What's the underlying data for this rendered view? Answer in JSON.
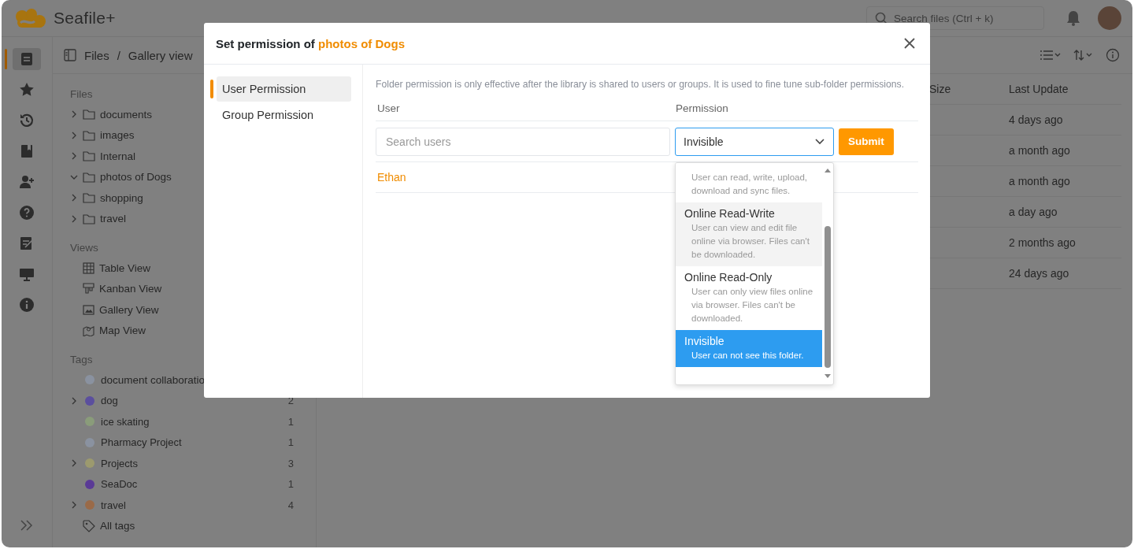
{
  "app": {
    "logo": "Seafile+",
    "search": {
      "placeholder": "Search files (Ctrl + k)"
    }
  },
  "rail": [
    {
      "kind": "files",
      "selected": true
    },
    {
      "kind": "star",
      "selected": false
    },
    {
      "kind": "history",
      "selected": false
    },
    {
      "kind": "book",
      "selected": false
    },
    {
      "kind": "useradd",
      "selected": false
    },
    {
      "kind": "help",
      "selected": false
    },
    {
      "kind": "notes",
      "selected": false
    },
    {
      "kind": "monitor",
      "selected": false
    },
    {
      "kind": "info",
      "selected": false
    }
  ],
  "sidebar": {
    "files_heading": "Files",
    "folders": [
      {
        "name": "documents",
        "expanded": false
      },
      {
        "name": "images",
        "expanded": false
      },
      {
        "name": "Internal",
        "expanded": false
      },
      {
        "name": "photos of Dogs",
        "expanded": true
      },
      {
        "name": "shopping",
        "expanded": false
      },
      {
        "name": "travel",
        "expanded": false
      }
    ],
    "views_heading": "Views",
    "views": [
      {
        "kind": "table",
        "label": "Table View"
      },
      {
        "kind": "kanban",
        "label": "Kanban View"
      },
      {
        "kind": "gallery",
        "label": "Gallery View"
      },
      {
        "kind": "map",
        "label": "Map View"
      }
    ],
    "tags_heading": "Tags",
    "tags": [
      {
        "name": "document collaboratio",
        "color": "#8a92a0",
        "expandable": false
      },
      {
        "name": "dog",
        "count": "2",
        "color": "#5b4f9e",
        "expandable": true
      },
      {
        "name": "ice skating",
        "count": "1",
        "color": "#8a9c7a",
        "expandable": false
      },
      {
        "name": "Pharmacy Project",
        "count": "1",
        "color": "#8a92a0",
        "expandable": false
      },
      {
        "name": "Projects",
        "count": "3",
        "color": "#9c9a6e",
        "expandable": true
      },
      {
        "name": "SeaDoc",
        "count": "1",
        "color": "#5a3a96",
        "expandable": false
      },
      {
        "name": "travel",
        "count": "4",
        "color": "#9a6a48",
        "expandable": true
      }
    ],
    "all_tags": "All tags"
  },
  "breadcrumb": {
    "items": [
      "Files",
      "Gallery view"
    ],
    "separator": "/"
  },
  "table": {
    "columns": [
      "Size",
      "Last Update"
    ],
    "rows": [
      "4 days ago",
      "a month ago",
      "a month ago",
      "a day ago",
      "2 months ago",
      "24 days ago"
    ]
  },
  "dialog": {
    "title": "Set permission of ",
    "folder": "photos of Dogs",
    "tabs": [
      {
        "label": "User Permission",
        "selected": true
      },
      {
        "label": "Group Permission",
        "selected": false
      }
    ],
    "notice": "Folder permission is only effective after the library is shared to users or groups. It is used to fine tune sub-folder permissions.",
    "columns": [
      "User",
      "Permission"
    ],
    "user_search": {
      "placeholder": "Search users"
    },
    "permission_value": "Invisible",
    "submit": "Submit",
    "users": [
      "Ethan"
    ],
    "options": [
      {
        "description": "User can read, write, upload, download and sync files.",
        "hovered": false,
        "selected": false
      },
      {
        "title": "Online Read-Write",
        "description": "User can view and edit file online via browser. Files can't be downloaded.",
        "hovered": true,
        "selected": false
      },
      {
        "title": "Online Read-Only",
        "description": "User can only view files online via browser. Files can't be downloaded.",
        "hovered": false,
        "selected": false
      },
      {
        "title": "Invisible",
        "description": "User can not see this folder.",
        "hovered": false,
        "selected": true
      }
    ]
  }
}
